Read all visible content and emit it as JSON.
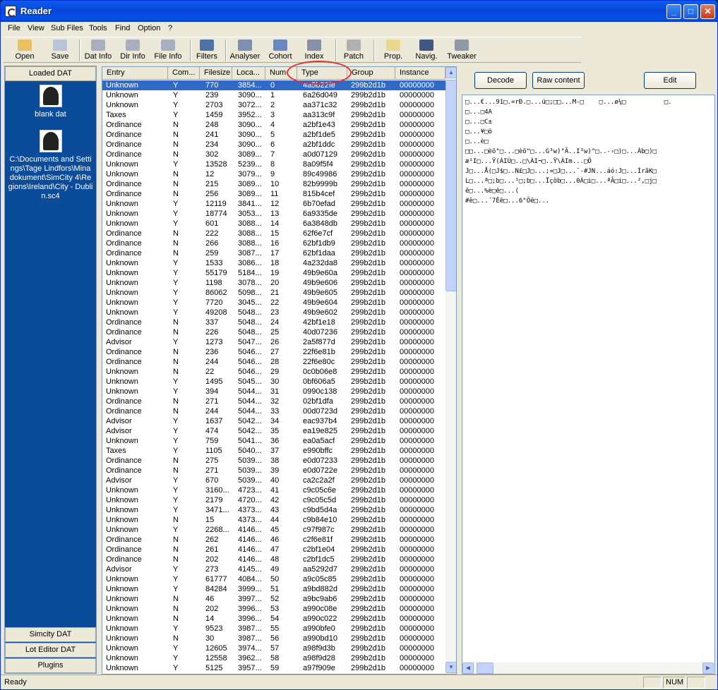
{
  "window": {
    "title": "Reader"
  },
  "menu": [
    "File",
    "View",
    "Sub Files",
    "Tools",
    "Find",
    "Option",
    "?"
  ],
  "toolbar": [
    {
      "label": "Open",
      "icon": "open-icon"
    },
    {
      "label": "Save",
      "icon": "save-icon"
    },
    {
      "label": "Dat Info",
      "icon": "dat-info-icon"
    },
    {
      "label": "Dir Info",
      "icon": "dir-info-icon"
    },
    {
      "label": "File Info",
      "icon": "file-info-icon"
    },
    {
      "label": "Filters",
      "icon": "filters-icon"
    },
    {
      "label": "Analyser",
      "icon": "analyser-icon"
    },
    {
      "label": "Cohort",
      "icon": "cohort-icon"
    },
    {
      "label": "Index",
      "icon": "index-icon"
    },
    {
      "label": "Patch",
      "icon": "patch-icon"
    },
    {
      "label": "Prop.",
      "icon": "prop-icon"
    },
    {
      "label": "Navig.",
      "icon": "navig-icon"
    },
    {
      "label": "Tweaker",
      "icon": "tweaker-icon"
    }
  ],
  "left_panel": {
    "header": "Loaded DAT",
    "dats": [
      {
        "label": "blank dat"
      },
      {
        "label": "C:\\Documents and Settings\\Tage Lindfors\\Mina dokument\\SimCity 4\\Regions\\Ireland\\City - Dublin.sc4"
      }
    ],
    "tabs": [
      "Simcity DAT",
      "Lot Editor DAT",
      "Plugins"
    ]
  },
  "grid": {
    "columns": [
      "Entry",
      "Com...",
      "Filesize",
      "Loca...",
      "Num",
      "Type",
      "Group",
      "Instance"
    ],
    "rows": [
      [
        "Unknown",
        "Y",
        "770",
        "3854...",
        "0",
        "4a5b22fe",
        "299b2d1b",
        "00000000"
      ],
      [
        "Unknown",
        "Y",
        "239",
        "3090...",
        "1",
        "6a26d049",
        "299b2d1b",
        "00000000"
      ],
      [
        "Unknown",
        "Y",
        "2703",
        "3072...",
        "2",
        "aa371c32",
        "299b2d1b",
        "00000000"
      ],
      [
        "Taxes",
        "Y",
        "1459",
        "3952...",
        "3",
        "aa313c9f",
        "299b2d1b",
        "00000000"
      ],
      [
        "Ordinance",
        "N",
        "248",
        "3090...",
        "4",
        "a2bf1e43",
        "299b2d1b",
        "00000000"
      ],
      [
        "Ordinance",
        "N",
        "241",
        "3090...",
        "5",
        "a2bf1de5",
        "299b2d1b",
        "00000000"
      ],
      [
        "Ordinance",
        "N",
        "234",
        "3090...",
        "6",
        "a2bf1ddc",
        "299b2d1b",
        "00000000"
      ],
      [
        "Ordinance",
        "N",
        "302",
        "3089...",
        "7",
        "a0d07129",
        "299b2d1b",
        "00000000"
      ],
      [
        "Unknown",
        "Y",
        "13528",
        "5239...",
        "8",
        "8a09f5f4",
        "299b2d1b",
        "00000000"
      ],
      [
        "Unknown",
        "N",
        "12",
        "3079...",
        "9",
        "89c49986",
        "299b2d1b",
        "00000000"
      ],
      [
        "Ordinance",
        "N",
        "215",
        "3089...",
        "10",
        "82b9999b",
        "299b2d1b",
        "00000000"
      ],
      [
        "Ordinance",
        "N",
        "256",
        "3089...",
        "11",
        "815b4cef",
        "299b2d1b",
        "00000000"
      ],
      [
        "Unknown",
        "Y",
        "12119",
        "3841...",
        "12",
        "6b70efad",
        "299b2d1b",
        "00000000"
      ],
      [
        "Unknown",
        "Y",
        "18774",
        "3053...",
        "13",
        "6a9335de",
        "299b2d1b",
        "00000000"
      ],
      [
        "Unknown",
        "Y",
        "601",
        "3088...",
        "14",
        "6a3848db",
        "299b2d1b",
        "00000000"
      ],
      [
        "Ordinance",
        "N",
        "222",
        "3088...",
        "15",
        "62f6e7cf",
        "299b2d1b",
        "00000000"
      ],
      [
        "Ordinance",
        "N",
        "266",
        "3088...",
        "16",
        "62bf1db9",
        "299b2d1b",
        "00000000"
      ],
      [
        "Ordinance",
        "N",
        "259",
        "3087...",
        "17",
        "62bf1daa",
        "299b2d1b",
        "00000000"
      ],
      [
        "Unknown",
        "Y",
        "1533",
        "3086...",
        "18",
        "4a232da8",
        "299b2d1b",
        "00000000"
      ],
      [
        "Unknown",
        "Y",
        "55179",
        "5184...",
        "19",
        "49b9e60a",
        "299b2d1b",
        "00000000"
      ],
      [
        "Unknown",
        "Y",
        "1198",
        "3078...",
        "20",
        "49b9e606",
        "299b2d1b",
        "00000000"
      ],
      [
        "Unknown",
        "Y",
        "86062",
        "5098...",
        "21",
        "49b9e605",
        "299b2d1b",
        "00000000"
      ],
      [
        "Unknown",
        "Y",
        "7720",
        "3045...",
        "22",
        "49b9e604",
        "299b2d1b",
        "00000000"
      ],
      [
        "Unknown",
        "Y",
        "49208",
        "5048...",
        "23",
        "49b9e602",
        "299b2d1b",
        "00000000"
      ],
      [
        "Ordinance",
        "N",
        "337",
        "5048...",
        "24",
        "42bf1e18",
        "299b2d1b",
        "00000000"
      ],
      [
        "Ordinance",
        "N",
        "226",
        "5048...",
        "25",
        "40d07236",
        "299b2d1b",
        "00000000"
      ],
      [
        "Advisor",
        "Y",
        "1273",
        "5047...",
        "26",
        "2a5f877d",
        "299b2d1b",
        "00000000"
      ],
      [
        "Ordinance",
        "N",
        "236",
        "5046...",
        "27",
        "22f6e81b",
        "299b2d1b",
        "00000000"
      ],
      [
        "Ordinance",
        "N",
        "244",
        "5046...",
        "28",
        "22f6e80c",
        "299b2d1b",
        "00000000"
      ],
      [
        "Unknown",
        "N",
        "22",
        "5046...",
        "29",
        "0c0b06e8",
        "299b2d1b",
        "00000000"
      ],
      [
        "Unknown",
        "Y",
        "1495",
        "5045...",
        "30",
        "0bf606a5",
        "299b2d1b",
        "00000000"
      ],
      [
        "Unknown",
        "Y",
        "394",
        "5044...",
        "31",
        "0990c138",
        "299b2d1b",
        "00000000"
      ],
      [
        "Ordinance",
        "N",
        "271",
        "5044...",
        "32",
        "02bf1dfa",
        "299b2d1b",
        "00000000"
      ],
      [
        "Ordinance",
        "N",
        "244",
        "5044...",
        "33",
        "00d0723d",
        "299b2d1b",
        "00000000"
      ],
      [
        "Advisor",
        "Y",
        "1637",
        "5042...",
        "34",
        "eac937b4",
        "299b2d1b",
        "00000000"
      ],
      [
        "Advisor",
        "Y",
        "474",
        "5042...",
        "35",
        "ea19e825",
        "299b2d1b",
        "00000000"
      ],
      [
        "Unknown",
        "Y",
        "759",
        "5041...",
        "36",
        "ea0a5acf",
        "299b2d1b",
        "00000000"
      ],
      [
        "Taxes",
        "Y",
        "1105",
        "5040...",
        "37",
        "e990bffc",
        "299b2d1b",
        "00000000"
      ],
      [
        "Ordinance",
        "N",
        "275",
        "5039...",
        "38",
        "e0d07233",
        "299b2d1b",
        "00000000"
      ],
      [
        "Ordinance",
        "N",
        "271",
        "5039...",
        "39",
        "e0d0722e",
        "299b2d1b",
        "00000000"
      ],
      [
        "Advisor",
        "Y",
        "670",
        "5039...",
        "40",
        "ca2c2a2f",
        "299b2d1b",
        "00000000"
      ],
      [
        "Unknown",
        "Y",
        "3160...",
        "4723...",
        "41",
        "c9c05c6e",
        "299b2d1b",
        "00000000"
      ],
      [
        "Unknown",
        "Y",
        "2179",
        "4720...",
        "42",
        "c9c05c5d",
        "299b2d1b",
        "00000000"
      ],
      [
        "Unknown",
        "Y",
        "3471...",
        "4373...",
        "43",
        "c9bd5d4a",
        "299b2d1b",
        "00000000"
      ],
      [
        "Unknown",
        "N",
        "15",
        "4373...",
        "44",
        "c9b84e10",
        "299b2d1b",
        "00000000"
      ],
      [
        "Unknown",
        "Y",
        "2268...",
        "4146...",
        "45",
        "c97f987c",
        "299b2d1b",
        "00000000"
      ],
      [
        "Ordinance",
        "N",
        "262",
        "4146...",
        "46",
        "c2f6e81f",
        "299b2d1b",
        "00000000"
      ],
      [
        "Ordinance",
        "N",
        "261",
        "4146...",
        "47",
        "c2bf1e04",
        "299b2d1b",
        "00000000"
      ],
      [
        "Ordinance",
        "N",
        "202",
        "4146...",
        "48",
        "c2bf1dc5",
        "299b2d1b",
        "00000000"
      ],
      [
        "Advisor",
        "Y",
        "273",
        "4145...",
        "49",
        "aa5292d7",
        "299b2d1b",
        "00000000"
      ],
      [
        "Unknown",
        "Y",
        "61777",
        "4084...",
        "50",
        "a9c05c85",
        "299b2d1b",
        "00000000"
      ],
      [
        "Unknown",
        "Y",
        "84284",
        "3999...",
        "51",
        "a9bd882d",
        "299b2d1b",
        "00000000"
      ],
      [
        "Unknown",
        "N",
        "46",
        "3997...",
        "52",
        "a9bc9ab6",
        "299b2d1b",
        "00000000"
      ],
      [
        "Unknown",
        "N",
        "202",
        "3996...",
        "53",
        "a990c08e",
        "299b2d1b",
        "00000000"
      ],
      [
        "Unknown",
        "N",
        "14",
        "3996...",
        "54",
        "a990c022",
        "299b2d1b",
        "00000000"
      ],
      [
        "Unknown",
        "Y",
        "9523",
        "3987...",
        "55",
        "a990bfe0",
        "299b2d1b",
        "00000000"
      ],
      [
        "Unknown",
        "N",
        "30",
        "3987...",
        "56",
        "a990bd10",
        "299b2d1b",
        "00000000"
      ],
      [
        "Unknown",
        "Y",
        "12605",
        "3974...",
        "57",
        "a98f9d3b",
        "299b2d1b",
        "00000000"
      ],
      [
        "Unknown",
        "Y",
        "12558",
        "3962...",
        "58",
        "a98f9d28",
        "299b2d1b",
        "00000000"
      ],
      [
        "Unknown",
        "Y",
        "5125",
        "3957...",
        "59",
        "a97f909e",
        "299b2d1b",
        "00000000"
      ]
    ],
    "selected_row": 0
  },
  "right_panel": {
    "decode_label": "Decode",
    "raw_label": "Raw content",
    "edit_label": "Edit",
    "hex_lines": [
      "□...€...91□.=rÐ.□...ú□;□□...M-□    □...ø¼□          □.",
      "□...□4A",
      "□...□C±",
      "□...¥□ö",
      "□...è□",
      "□□...□èö\"□...□èö\"□...G³w)°Ã..I³w)^□..-›□)□...Àb□)□",
      "æ¹I□...Ÿ(ÀIÙ□..□\\ÀI¬□..Ÿ\\ÀIm...□Ö",
      "J□...Å(□J$□..N£□J□...;»□J□...¨-#JN...áó:J□...ÍrãK□",
      "L□...ª□;b□...¹□;b□...Ïçöb□...0À□i□...ªÃ□i□...²,□j□",
      "ê□...%è□ê□...(",
      "#ê□...´7Êê□...6°Ôê□..."
    ]
  },
  "status": {
    "text": "Ready",
    "num": "NUM"
  }
}
